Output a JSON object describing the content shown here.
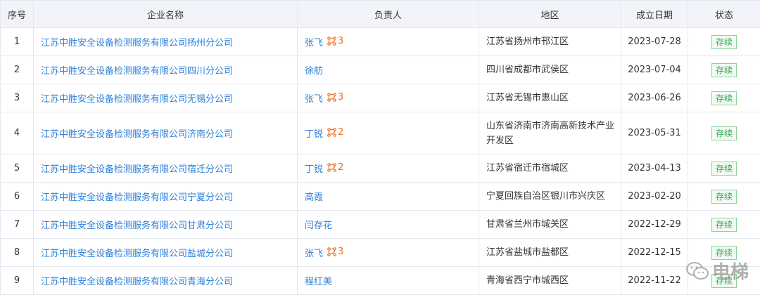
{
  "table": {
    "headers": {
      "index": "序号",
      "company": "企业名称",
      "person": "负责人",
      "region": "地区",
      "date": "成立日期",
      "status": "状态"
    },
    "rows": [
      {
        "index": "1",
        "company": "江苏中胜安全设备检测服务有限公司扬州分公司",
        "person": "张飞",
        "rel_count": "3",
        "region": "江苏省扬州市邗江区",
        "date": "2023-07-28",
        "status": "存续"
      },
      {
        "index": "2",
        "company": "江苏中胜安全设备检测服务有限公司四川分公司",
        "person": "徐舫",
        "rel_count": "",
        "region": "四川省成都市武侯区",
        "date": "2023-07-04",
        "status": "存续"
      },
      {
        "index": "3",
        "company": "江苏中胜安全设备检测服务有限公司无锡分公司",
        "person": "张飞",
        "rel_count": "3",
        "region": "江苏省无锡市惠山区",
        "date": "2023-06-26",
        "status": "存续"
      },
      {
        "index": "4",
        "company": "江苏中胜安全设备检测服务有限公司济南分公司",
        "person": "丁锐",
        "rel_count": "2",
        "region": "山东省济南市济南高新技术产业开发区",
        "date": "2023-05-31",
        "status": "存续"
      },
      {
        "index": "5",
        "company": "江苏中胜安全设备检测服务有限公司宿迁分公司",
        "person": "丁锐",
        "rel_count": "2",
        "region": "江苏省宿迁市宿城区",
        "date": "2023-04-13",
        "status": "存续"
      },
      {
        "index": "6",
        "company": "江苏中胜安全设备检测服务有限公司宁夏分公司",
        "person": "高霞",
        "rel_count": "",
        "region": "宁夏回族自治区银川市兴庆区",
        "date": "2023-02-20",
        "status": "存续"
      },
      {
        "index": "7",
        "company": "江苏中胜安全设备检测服务有限公司甘肃分公司",
        "person": "闫存花",
        "rel_count": "",
        "region": "甘肃省兰州市城关区",
        "date": "2022-12-29",
        "status": "存续"
      },
      {
        "index": "8",
        "company": "江苏中胜安全设备检测服务有限公司盐城分公司",
        "person": "张飞",
        "rel_count": "3",
        "region": "江苏省盐城市盐都区",
        "date": "2022-12-15",
        "status": "存续"
      },
      {
        "index": "9",
        "company": "江苏中胜安全设备检测服务有限公司青海分公司",
        "person": "程红美",
        "rel_count": "",
        "region": "青海省西宁市城西区",
        "date": "2022-11-22",
        "status": "存续"
      }
    ]
  },
  "watermark": {
    "text": "电梯"
  },
  "colors": {
    "link": "#2f80d9",
    "relation": "#f06d1e",
    "status_green": "#2aa84a",
    "header_bg": "#f2f4fa"
  }
}
